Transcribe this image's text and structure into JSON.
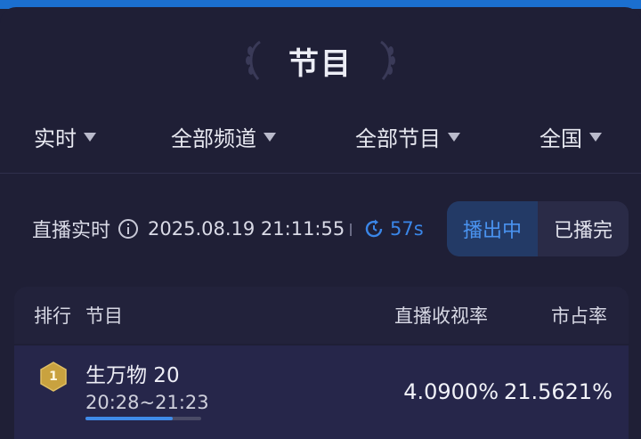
{
  "page": {
    "title": "节目"
  },
  "filters": [
    {
      "label": "实时"
    },
    {
      "label": "全部频道"
    },
    {
      "label": "全部节目"
    },
    {
      "label": "全国"
    }
  ],
  "status": {
    "live_label": "直播实时",
    "timestamp": "2025.08.19 21:11:55",
    "countdown": "57s",
    "tabs": [
      {
        "label": "播出中",
        "active": true
      },
      {
        "label": "已播完",
        "active": false
      }
    ]
  },
  "table": {
    "headers": {
      "rank": "排行",
      "program": "节目",
      "rating": "直播收视率",
      "share": "市占率"
    },
    "rows": [
      {
        "rank": "1",
        "name": "生万物 20",
        "time": "20:28~21:23",
        "progress": 0.75,
        "rating": "4.0900%",
        "share": "21.5621%"
      }
    ]
  },
  "colors": {
    "accent": "#3a86e8",
    "badge_gold": "#c9a23f",
    "background": "#1f1f36"
  }
}
